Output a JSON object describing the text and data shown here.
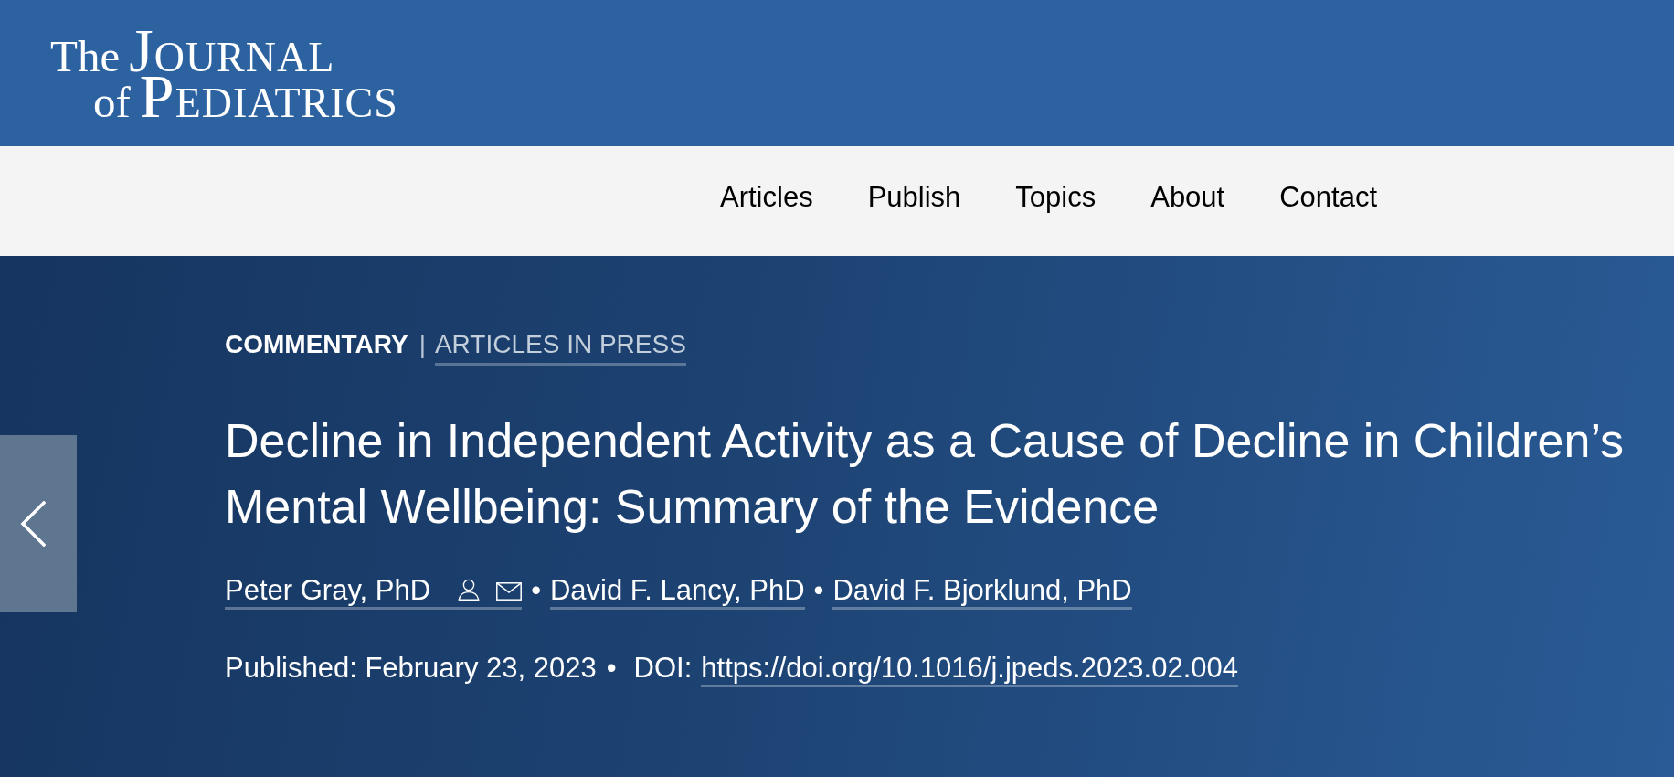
{
  "header": {
    "logo": {
      "lines": [
        {
          "lead": "The",
          "main": "JOURNAL"
        },
        {
          "lead": "of",
          "main": "PEDIATRICS"
        }
      ]
    }
  },
  "nav": {
    "items": [
      "Articles",
      "Publish",
      "Topics",
      "About",
      "Contact"
    ]
  },
  "article": {
    "category": "COMMENTARY",
    "separator": "|",
    "status": "ARTICLES IN PRESS",
    "title": "Decline in Independent Activity as a Cause of Decline in Children’s Mental Wellbeing: Summary of the Evidence",
    "authors": [
      {
        "name": "Peter Gray, PhD",
        "corresponding": true
      },
      {
        "separator": "•",
        "name": "David F. Lancy, PhD",
        "corresponding": false
      },
      {
        "separator": "•",
        "name": "David F. Bjorklund, PhD",
        "corresponding": false
      }
    ],
    "published": "Published: February 23, 2023",
    "published_separator": "•",
    "doi_label": "DOI:",
    "doi": "https://doi.org/10.1016/j.jpeds.2023.02.004"
  }
}
